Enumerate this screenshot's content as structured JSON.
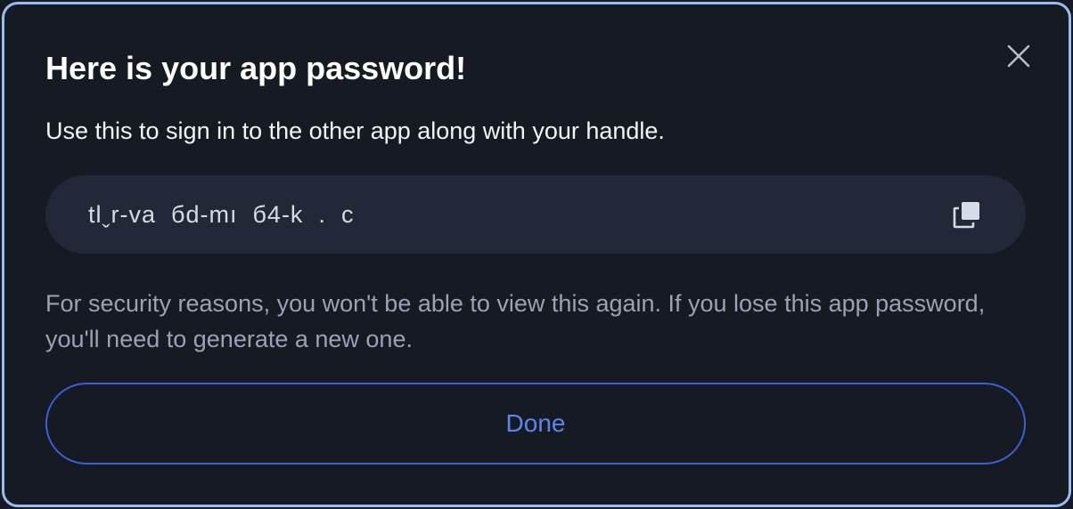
{
  "dialog": {
    "title": "Here is your app password!",
    "subtitle": "Use this to sign in to the other app along with your handle.",
    "password": "tlˬr-va  бd-mı  б4-k  .  c",
    "warning": "For security reasons, you won't be able to view this again. If you lose this app password, you'll need to generate a new one.",
    "done_label": "Done",
    "close_icon": "close-icon",
    "copy_icon": "copy-icon"
  },
  "colors": {
    "background": "#161a22",
    "border": "#9cbbf0",
    "field": "#232838",
    "accent": "#3a5fd9",
    "accent_text": "#5b86f0",
    "muted_text": "#9aa2b4"
  }
}
